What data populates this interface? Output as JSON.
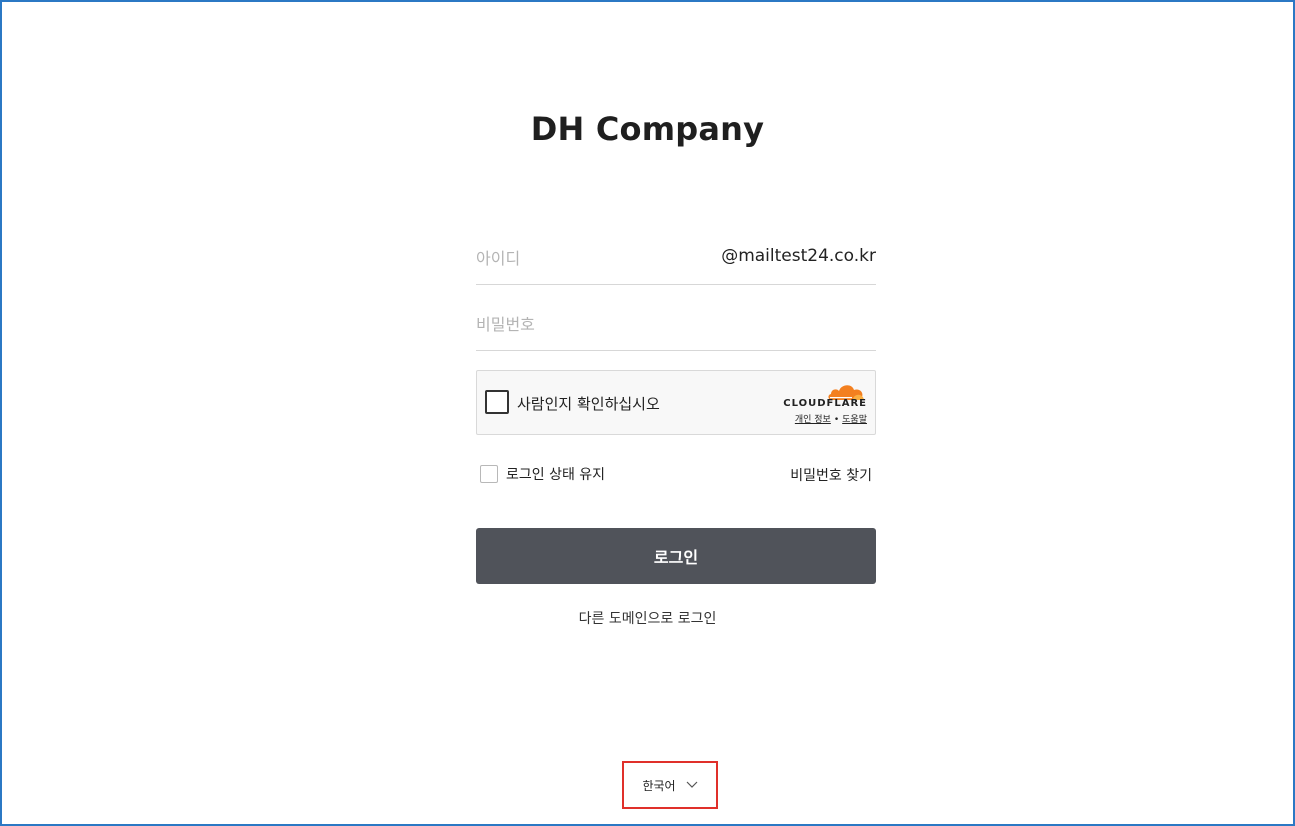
{
  "brand": {
    "title": "DH Company"
  },
  "login_form": {
    "id_placeholder": "아이디",
    "domain": "@mailtest24.co.kr",
    "password_placeholder": "비밀번호",
    "captcha": {
      "label": "사람인지 확인하십시오",
      "provider": "CLOUDFLARE",
      "privacy_link": "개인 정보",
      "terms_link": "도움말"
    },
    "keep_login_label": "로그인 상태 유지",
    "find_password_label": "비밀번호 찾기",
    "login_button_label": "로그인",
    "other_domain_label": "다른 도메인으로 로그인"
  },
  "footer": {
    "language": "한국어"
  },
  "colors": {
    "button": "#50535a",
    "frame": "#2b78c4",
    "highlight": "#e0302a",
    "cloudflare": "#f38020"
  }
}
